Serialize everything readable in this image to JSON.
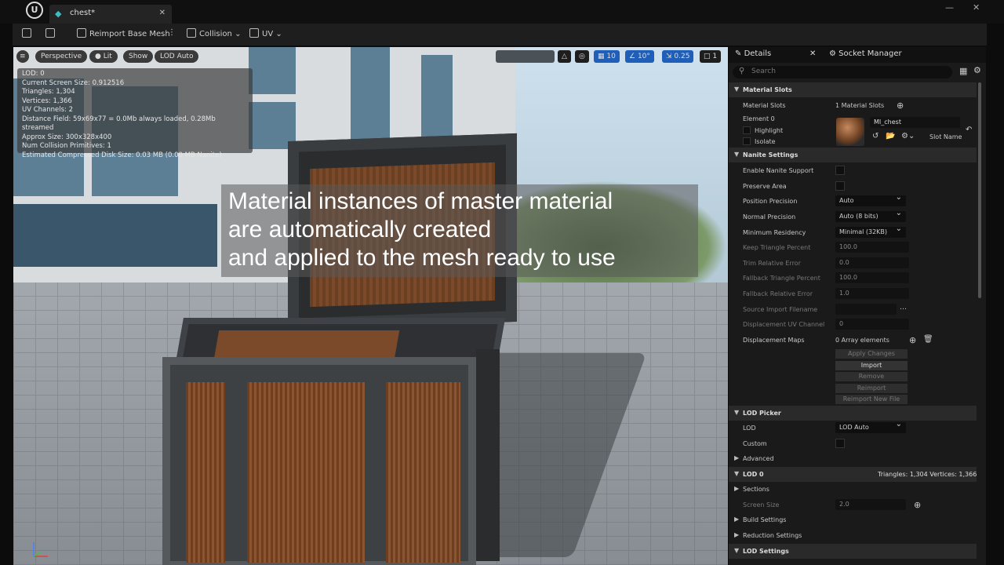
{
  "window": {
    "tab_title": "chest",
    "tab_dirty": "*"
  },
  "toolbar": {
    "reimport_label": "Reimport Base Mesh",
    "collision_label": "Collision",
    "uv_label": "UV"
  },
  "viewport": {
    "buttons": {
      "menu": "≡",
      "perspective": "Perspective",
      "lit": "Lit",
      "show": "Show",
      "lod": "LOD Auto"
    },
    "right_controls": {
      "grid": "10",
      "angle": "10°",
      "scale": "0.25",
      "camera": "1"
    },
    "stats": [
      "LOD:  0",
      "Current Screen Size:  0.912516",
      "Triangles:  1,304",
      "Vertices:  1,366",
      "UV Channels:  2",
      "Distance Field:  59x69x77 = 0.0Mb always loaded, 0.28Mb streamed",
      "Approx Size: 300x328x400",
      "Num Collision Primitives:  1",
      "Estimated Compressed Disk Size: 0.03 MB (0.00 MB Nanite)"
    ],
    "caption": [
      "Material instances of master material",
      "are automatically created",
      "and applied to the mesh ready to use"
    ]
  },
  "details": {
    "tabs": {
      "details": "Details",
      "socket": "Socket Manager"
    },
    "search_placeholder": "Search",
    "material_slots": {
      "section": "Material Slots",
      "label": "Material Slots",
      "count": "1 Material Slots",
      "element": "Element 0",
      "highlight": "Highlight",
      "isolate": "Isolate",
      "material": "MI_chest",
      "slot_name": "Slot Name"
    },
    "nanite": {
      "section": "Nanite Settings",
      "enable": "Enable Nanite Support",
      "preserve": "Preserve Area",
      "position_precision": {
        "label": "Position Precision",
        "value": "Auto"
      },
      "normal_precision": {
        "label": "Normal Precision",
        "value": "Auto (8 bits)"
      },
      "min_residency": {
        "label": "Minimum Residency",
        "value": "Minimal (32KB)"
      },
      "keep_triangle": {
        "label": "Keep Triangle Percent",
        "value": "100.0"
      },
      "trim_error": {
        "label": "Trim Relative Error",
        "value": "0.0"
      },
      "fallback_triangle": {
        "label": "Fallback Triangle Percent",
        "value": "100.0"
      },
      "fallback_error": {
        "label": "Fallback Relative Error",
        "value": "1.0"
      },
      "source_file": {
        "label": "Source Import Filename",
        "value": ""
      },
      "displacement_uv": {
        "label": "Displacement UV Channel",
        "value": "0"
      },
      "displacement_maps": {
        "label": "Displacement Maps",
        "value": "0 Array elements"
      },
      "buttons": [
        "Apply Changes",
        "Import",
        "Remove",
        "Reimport",
        "Reimport New File"
      ]
    },
    "lod_picker": {
      "section": "LOD Picker",
      "lod_label": "LOD",
      "lod_value": "LOD Auto",
      "custom": "Custom",
      "advanced": "Advanced"
    },
    "lod0": {
      "section": "LOD 0",
      "stats": "Triangles: 1,304  Vertices: 1,366",
      "sections": "Sections",
      "screen_size": {
        "label": "Screen Size",
        "value": "2.0"
      },
      "build": "Build Settings",
      "reduction": "Reduction Settings"
    },
    "lod_settings": {
      "section": "LOD Settings"
    }
  }
}
